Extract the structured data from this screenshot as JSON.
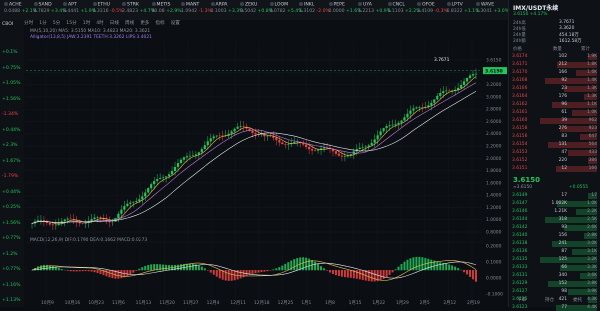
{
  "tickers": [
    {
      "name": "ACHE",
      "price": "0.0488",
      "chg": "+2.1%",
      "dir": "up"
    },
    {
      "name": "SAND",
      "price": "0.7829",
      "chg": "+3.4%",
      "dir": "up"
    },
    {
      "name": "APT",
      "price": "8.4441",
      "chg": "+1.9%",
      "dir": "up"
    },
    {
      "name": "ETHU",
      "price": "0.3316",
      "chg": "-0.5%",
      "dir": "dn"
    },
    {
      "name": "STRK",
      "price": "2.4823",
      "chg": "+4.7%",
      "dir": "up"
    },
    {
      "name": "METIS",
      "price": "90.08",
      "chg": "+2.9%",
      "dir": "up"
    },
    {
      "name": "MANT",
      "price": "1.0942",
      "chg": "-1.3%",
      "dir": "dn"
    },
    {
      "name": "ARPA",
      "price": "0.1003",
      "chg": "+3.3%",
      "dir": "up"
    },
    {
      "name": "ZEKU",
      "price": "0.5042",
      "chg": "+0.8%",
      "dir": "up"
    },
    {
      "name": "LOOM",
      "price": "0.0782",
      "chg": "+5.4%",
      "dir": "up"
    },
    {
      "name": "INKL",
      "price": "1.3102",
      "chg": "-2.0%",
      "dir": "dn"
    },
    {
      "name": "PEPE",
      "price": "0.0000",
      "chg": "+1.6%",
      "dir": "up"
    },
    {
      "name": "UYA",
      "price": "1.2213",
      "chg": "+0.9%",
      "dir": "up"
    },
    {
      "name": "CNCL",
      "price": "1.1103",
      "chg": "+2.2%",
      "dir": "up"
    },
    {
      "name": "OFOE",
      "price": "2.4109",
      "chg": "-0.3%",
      "dir": "dn"
    },
    {
      "name": "LPTV",
      "price": "6.8322",
      "chg": "+1.1%",
      "dir": "up"
    },
    {
      "name": "WAVE",
      "price": "1.3041",
      "chg": "+3.0%",
      "dir": "up"
    }
  ],
  "left_column": {
    "label": "CBOI",
    "percents": [
      "+0.1%",
      "+0.75%",
      "+1.05%",
      "+1.56%",
      "-1.34%",
      "+0.44%",
      "+2.3%",
      "+1.67%",
      "-1.79%",
      "+0.44%",
      "+0.25%",
      "+1.56%",
      "+0.77%",
      "+1.2%",
      "+0.77%",
      "+1.16%",
      "+1.13%"
    ]
  },
  "toolbar": {
    "items": [
      "分时",
      "1分",
      "5分",
      "15分",
      "1时",
      "4时",
      "日线",
      "周线",
      "更多",
      "指标",
      "设置"
    ]
  },
  "legends": {
    "ma": "MA(5,10,20) MA5: 3.5150 MA10: 3.4823 MA20: 3.3621",
    "alligator": "Alligator(13,8,5) JAW:3.2391 TEETH:3.3262 LIPS:3.4021",
    "macd": "MACD(12,26,9) DIF:0.1790 DEA:0.1662 MACD:0.0273"
  },
  "chart_data": {
    "type": "candlestick",
    "y_axis": [
      "3.6150",
      "3.4000",
      "3.2000",
      "3.0000",
      "2.8000",
      "2.6000",
      "2.4000",
      "2.2000",
      "2.0000",
      "1.8000",
      "1.6000",
      "1.4000",
      "1.2000",
      "1.0000",
      "0.8000"
    ],
    "x_axis": [
      "10月9",
      "10月16",
      "10月23",
      "11月6",
      "11月13",
      "11月20",
      "11月27",
      "12月4",
      "12月11",
      "12月18",
      "12月25",
      "1月1",
      "1月8",
      "1月15",
      "1月22",
      "1月29",
      "2月5",
      "2月12",
      "2月19"
    ],
    "high_marker": "3.7671",
    "last_price": "3.6150",
    "macd_axis": [
      "0.2000",
      "0.1000",
      "0.0000",
      "-0.1000"
    ]
  },
  "side": {
    "symbol": "IMX/USDT永续",
    "sub": "3.6150 +4.17%",
    "stats": [
      {
        "label": "24h高",
        "value": "3.7671"
      },
      {
        "label": "24h低",
        "value": "3.3620"
      },
      {
        "label": "24h量",
        "value": "454.18万"
      },
      {
        "label": "24h额",
        "value": "1612.58万"
      }
    ],
    "book_header": [
      "价格",
      "数量",
      "累计"
    ],
    "asks": [
      {
        "p": "3.6174",
        "q": "102",
        "t": "1.9K"
      },
      {
        "p": "3.6171",
        "q": "212",
        "t": "1.8K"
      },
      {
        "p": "3.6170",
        "q": "166",
        "t": "1.6K"
      },
      {
        "p": "3.6168",
        "q": "92",
        "t": "1.4K"
      },
      {
        "p": "3.6166",
        "q": "23",
        "t": "1.3K"
      },
      {
        "p": "3.6164",
        "q": "176",
        "t": "1.3K"
      },
      {
        "p": "3.6162",
        "q": "96",
        "t": "1.1K"
      },
      {
        "p": "3.6161",
        "q": "61",
        "t": "1.0K"
      },
      {
        "p": "3.6160",
        "q": "39",
        "t": "962"
      },
      {
        "p": "3.6158",
        "q": "276",
        "t": "923"
      },
      {
        "p": "3.6156",
        "q": "83",
        "t": "647"
      },
      {
        "p": "3.6154",
        "q": "131",
        "t": "564"
      },
      {
        "p": "3.6153",
        "q": "47",
        "t": "433"
      },
      {
        "p": "3.6152",
        "q": "220",
        "t": "386"
      },
      {
        "p": "3.6151",
        "q": "12",
        "t": "166"
      }
    ],
    "mid": {
      "price": "3.6150",
      "sub": "≈3.6150",
      "chg": "+0.0555"
    },
    "bids": [
      {
        "p": "3.6149",
        "q": "17",
        "t": "17"
      },
      {
        "p": "3.6147",
        "q": "1.002K",
        "t": "1.0K"
      },
      {
        "p": "3.6146",
        "q": "1.21K",
        "t": "2.2K"
      },
      {
        "p": "3.6144",
        "q": "318",
        "t": "2.5K"
      },
      {
        "p": "3.6142",
        "q": "93",
        "t": "2.6K"
      },
      {
        "p": "3.6140",
        "q": "156",
        "t": "2.8K"
      },
      {
        "p": "3.6138",
        "q": "241",
        "t": "3.0K"
      },
      {
        "p": "3.6136",
        "q": "87",
        "t": "3.1K"
      },
      {
        "p": "3.6135",
        "q": "125",
        "t": "3.2K"
      },
      {
        "p": "3.6133",
        "q": "66",
        "t": "3.3K"
      },
      {
        "p": "3.6131",
        "q": "340",
        "t": "3.6K"
      },
      {
        "p": "3.6129",
        "q": "152",
        "t": "3.8K"
      },
      {
        "p": "3.6127",
        "q": "98",
        "t": "3.9K"
      },
      {
        "p": "3.6125",
        "q": "421",
        "t": "4.3K"
      },
      {
        "p": "3.6123",
        "q": "77",
        "t": "4.4K"
      }
    ],
    "bottom_tabs": [
      "下单",
      "持仓",
      "委托"
    ],
    "colors": {
      "up": "#22c55e",
      "down": "#ef4444",
      "accent": "#22c55e"
    }
  }
}
